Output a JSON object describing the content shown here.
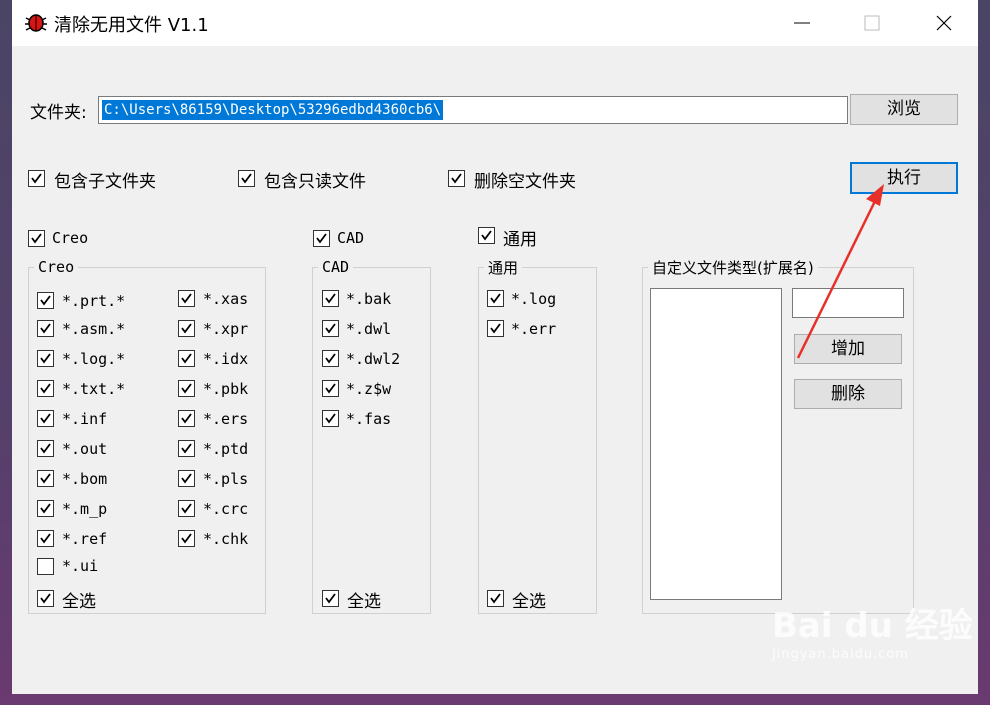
{
  "window": {
    "title": "清除无用文件  V1.1"
  },
  "folder": {
    "label": "文件夹:",
    "path": "C:\\Users\\86159\\Desktop\\53296edbd4360cb6\\",
    "browse_label": "浏览"
  },
  "options": [
    {
      "label": "包含子文件夹",
      "checked": true
    },
    {
      "label": "包含只读文件",
      "checked": true
    },
    {
      "label": "删除空文件夹",
      "checked": true
    }
  ],
  "execute_label": "执行",
  "categories": {
    "creo": {
      "toggle": "Creo",
      "group_title": "Creo",
      "col1": [
        "*.prt.*",
        "*.asm.*",
        "*.log.*",
        "*.txt.*",
        "*.inf",
        "*.out",
        "*.bom",
        "*.m_p",
        "*.ref",
        "*.ui"
      ],
      "col1_checked": [
        true,
        true,
        true,
        true,
        true,
        true,
        true,
        true,
        true,
        false
      ],
      "col2": [
        "*.xas",
        "*.xpr",
        "*.idx",
        "*.pbk",
        "*.ers",
        "*.ptd",
        "*.pls",
        "*.crc",
        "*.chk"
      ],
      "select_all": "全选"
    },
    "cad": {
      "toggle": "CAD",
      "group_title": "CAD",
      "items": [
        "*.bak",
        "*.dwl",
        "*.dwl2",
        "*.z$w",
        "*.fas"
      ],
      "select_all": "全选"
    },
    "general": {
      "toggle": "通用",
      "group_title": "通用",
      "items": [
        "*.log",
        "*.err"
      ],
      "select_all": "全选"
    }
  },
  "custom": {
    "group_title": "自定义文件类型(扩展名)",
    "ext_value": "",
    "add_label": "增加",
    "delete_label": "删除"
  },
  "watermark": {
    "logo": "Bai du 经验",
    "sub": "jingyan.baidu.com"
  },
  "colors": {
    "accent": "#0078d7",
    "arrow": "#e8302a",
    "window_bg": "#f0f0f0"
  }
}
